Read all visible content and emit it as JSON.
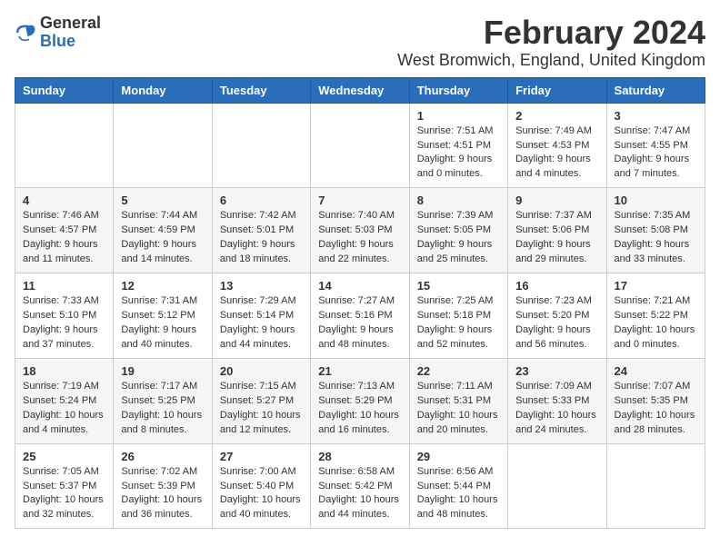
{
  "logo": {
    "general": "General",
    "blue": "Blue"
  },
  "title": "February 2024",
  "location": "West Bromwich, England, United Kingdom",
  "days_of_week": [
    "Sunday",
    "Monday",
    "Tuesday",
    "Wednesday",
    "Thursday",
    "Friday",
    "Saturday"
  ],
  "weeks": [
    [
      {
        "day": "",
        "info": ""
      },
      {
        "day": "",
        "info": ""
      },
      {
        "day": "",
        "info": ""
      },
      {
        "day": "",
        "info": ""
      },
      {
        "day": "1",
        "info": "Sunrise: 7:51 AM\nSunset: 4:51 PM\nDaylight: 9 hours\nand 0 minutes."
      },
      {
        "day": "2",
        "info": "Sunrise: 7:49 AM\nSunset: 4:53 PM\nDaylight: 9 hours\nand 4 minutes."
      },
      {
        "day": "3",
        "info": "Sunrise: 7:47 AM\nSunset: 4:55 PM\nDaylight: 9 hours\nand 7 minutes."
      }
    ],
    [
      {
        "day": "4",
        "info": "Sunrise: 7:46 AM\nSunset: 4:57 PM\nDaylight: 9 hours\nand 11 minutes."
      },
      {
        "day": "5",
        "info": "Sunrise: 7:44 AM\nSunset: 4:59 PM\nDaylight: 9 hours\nand 14 minutes."
      },
      {
        "day": "6",
        "info": "Sunrise: 7:42 AM\nSunset: 5:01 PM\nDaylight: 9 hours\nand 18 minutes."
      },
      {
        "day": "7",
        "info": "Sunrise: 7:40 AM\nSunset: 5:03 PM\nDaylight: 9 hours\nand 22 minutes."
      },
      {
        "day": "8",
        "info": "Sunrise: 7:39 AM\nSunset: 5:05 PM\nDaylight: 9 hours\nand 25 minutes."
      },
      {
        "day": "9",
        "info": "Sunrise: 7:37 AM\nSunset: 5:06 PM\nDaylight: 9 hours\nand 29 minutes."
      },
      {
        "day": "10",
        "info": "Sunrise: 7:35 AM\nSunset: 5:08 PM\nDaylight: 9 hours\nand 33 minutes."
      }
    ],
    [
      {
        "day": "11",
        "info": "Sunrise: 7:33 AM\nSunset: 5:10 PM\nDaylight: 9 hours\nand 37 minutes."
      },
      {
        "day": "12",
        "info": "Sunrise: 7:31 AM\nSunset: 5:12 PM\nDaylight: 9 hours\nand 40 minutes."
      },
      {
        "day": "13",
        "info": "Sunrise: 7:29 AM\nSunset: 5:14 PM\nDaylight: 9 hours\nand 44 minutes."
      },
      {
        "day": "14",
        "info": "Sunrise: 7:27 AM\nSunset: 5:16 PM\nDaylight: 9 hours\nand 48 minutes."
      },
      {
        "day": "15",
        "info": "Sunrise: 7:25 AM\nSunset: 5:18 PM\nDaylight: 9 hours\nand 52 minutes."
      },
      {
        "day": "16",
        "info": "Sunrise: 7:23 AM\nSunset: 5:20 PM\nDaylight: 9 hours\nand 56 minutes."
      },
      {
        "day": "17",
        "info": "Sunrise: 7:21 AM\nSunset: 5:22 PM\nDaylight: 10 hours\nand 0 minutes."
      }
    ],
    [
      {
        "day": "18",
        "info": "Sunrise: 7:19 AM\nSunset: 5:24 PM\nDaylight: 10 hours\nand 4 minutes."
      },
      {
        "day": "19",
        "info": "Sunrise: 7:17 AM\nSunset: 5:25 PM\nDaylight: 10 hours\nand 8 minutes."
      },
      {
        "day": "20",
        "info": "Sunrise: 7:15 AM\nSunset: 5:27 PM\nDaylight: 10 hours\nand 12 minutes."
      },
      {
        "day": "21",
        "info": "Sunrise: 7:13 AM\nSunset: 5:29 PM\nDaylight: 10 hours\nand 16 minutes."
      },
      {
        "day": "22",
        "info": "Sunrise: 7:11 AM\nSunset: 5:31 PM\nDaylight: 10 hours\nand 20 minutes."
      },
      {
        "day": "23",
        "info": "Sunrise: 7:09 AM\nSunset: 5:33 PM\nDaylight: 10 hours\nand 24 minutes."
      },
      {
        "day": "24",
        "info": "Sunrise: 7:07 AM\nSunset: 5:35 PM\nDaylight: 10 hours\nand 28 minutes."
      }
    ],
    [
      {
        "day": "25",
        "info": "Sunrise: 7:05 AM\nSunset: 5:37 PM\nDaylight: 10 hours\nand 32 minutes."
      },
      {
        "day": "26",
        "info": "Sunrise: 7:02 AM\nSunset: 5:39 PM\nDaylight: 10 hours\nand 36 minutes."
      },
      {
        "day": "27",
        "info": "Sunrise: 7:00 AM\nSunset: 5:40 PM\nDaylight: 10 hours\nand 40 minutes."
      },
      {
        "day": "28",
        "info": "Sunrise: 6:58 AM\nSunset: 5:42 PM\nDaylight: 10 hours\nand 44 minutes."
      },
      {
        "day": "29",
        "info": "Sunrise: 6:56 AM\nSunset: 5:44 PM\nDaylight: 10 hours\nand 48 minutes."
      },
      {
        "day": "",
        "info": ""
      },
      {
        "day": "",
        "info": ""
      }
    ]
  ]
}
